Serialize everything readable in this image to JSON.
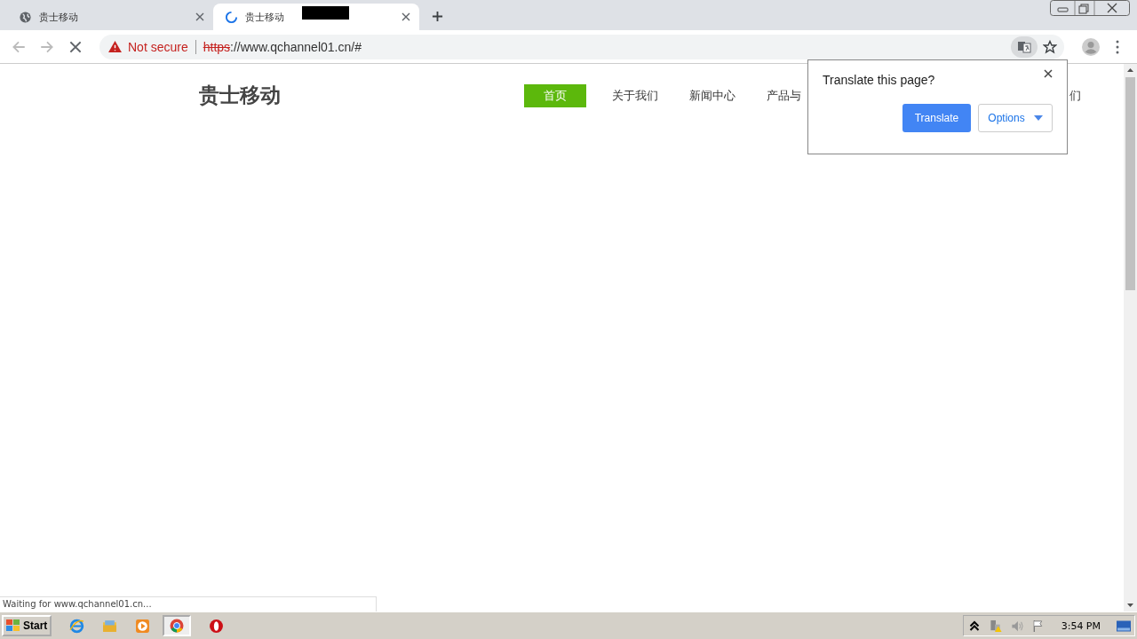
{
  "tabs": [
    {
      "title": "贵士移动",
      "selected": false,
      "loading": false
    },
    {
      "title": "贵士移动",
      "selected": true,
      "loading": true
    }
  ],
  "address_bar": {
    "security": "Not secure",
    "scheme": "https",
    "rest": "://www.qchannel01.cn/#"
  },
  "site": {
    "logo": "贵士移动",
    "nav": [
      {
        "label": "首页",
        "selected": true
      },
      {
        "label": "关于我们",
        "selected": false
      },
      {
        "label": "新闻中心",
        "selected": false
      },
      {
        "label": "产品与",
        "selected": false
      },
      {
        "label": "们",
        "selected": false
      }
    ]
  },
  "translate_popup": {
    "title": "Translate this page?",
    "primary": "Translate",
    "secondary": "Options"
  },
  "status_text": "Waiting for www.qchannel01.cn...",
  "taskbar": {
    "start": "Start",
    "clock": "3:54 PM"
  }
}
